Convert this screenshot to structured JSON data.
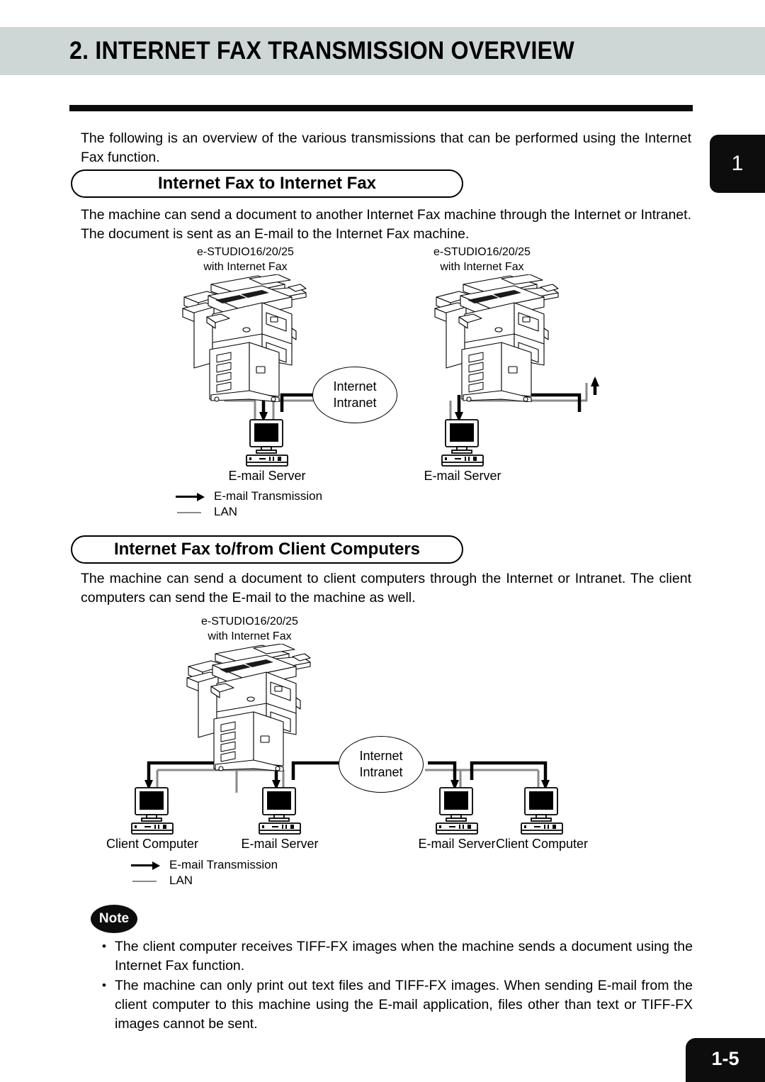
{
  "header": {
    "title": "2. INTERNET FAX TRANSMISSION OVERVIEW",
    "background_color": "#ced6d6"
  },
  "chapter_tab": {
    "label": "1"
  },
  "intro": {
    "text": "The following is an overview of the various transmissions that can be performed using the Internet Fax function."
  },
  "sections": [
    {
      "heading": "Internet Fax to Internet Fax",
      "body": "The machine can send a document to another Internet Fax machine through the Internet or Intranet. The document is sent as an E-mail to the Internet Fax machine.",
      "diagram": {
        "devices": [
          {
            "name": "copier-left",
            "label_line1": "e-STUDIO16/20/25",
            "label_line2": "with Internet Fax"
          },
          {
            "name": "copier-right",
            "label_line1": "e-STUDIO16/20/25",
            "label_line2": "with Internet Fax"
          }
        ],
        "network": {
          "line1": "Internet",
          "line2": "Intranet"
        },
        "nodes": [
          {
            "name": "email-server-left",
            "label": "E-mail Server"
          },
          {
            "name": "email-server-right",
            "label": "E-mail Server"
          }
        ],
        "legend": [
          {
            "type": "arrow",
            "label": "E-mail Transmission"
          },
          {
            "type": "line",
            "label": "LAN"
          }
        ]
      }
    },
    {
      "heading": "Internet Fax to/from Client Computers",
      "body": "The machine can send a document to client computers through the Internet or Intranet.  The client computers can send the E-mail to the machine as well.",
      "diagram": {
        "devices": [
          {
            "name": "copier",
            "label_line1": "e-STUDIO16/20/25",
            "label_line2": "with Internet Fax"
          }
        ],
        "network": {
          "line1": "Internet",
          "line2": "Intranet"
        },
        "nodes": [
          {
            "name": "client-computer-left",
            "label": "Client Computer"
          },
          {
            "name": "email-server-left",
            "label": "E-mail Server"
          },
          {
            "name": "email-server-right",
            "label": "E-mail Server"
          },
          {
            "name": "client-computer-right",
            "label": "Client Computer"
          }
        ],
        "legend": [
          {
            "type": "arrow",
            "label": "E-mail Transmission"
          },
          {
            "type": "line",
            "label": "LAN"
          }
        ]
      }
    }
  ],
  "note": {
    "badge": "Note",
    "items": [
      "The client computer receives TIFF-FX images when the machine sends a document using the Internet Fax function.",
      "The machine can only print out text files and TIFF-FX images.  When sending E-mail from the client computer to this machine using the E-mail application, files other than text or TIFF-FX images cannot be sent."
    ],
    "bullet": "•"
  },
  "page_number": "1-5",
  "colors": {
    "header_bg": "#ced6d6",
    "tab_black": "#0d0d0d",
    "lan_gray": "#8a8a8a"
  }
}
